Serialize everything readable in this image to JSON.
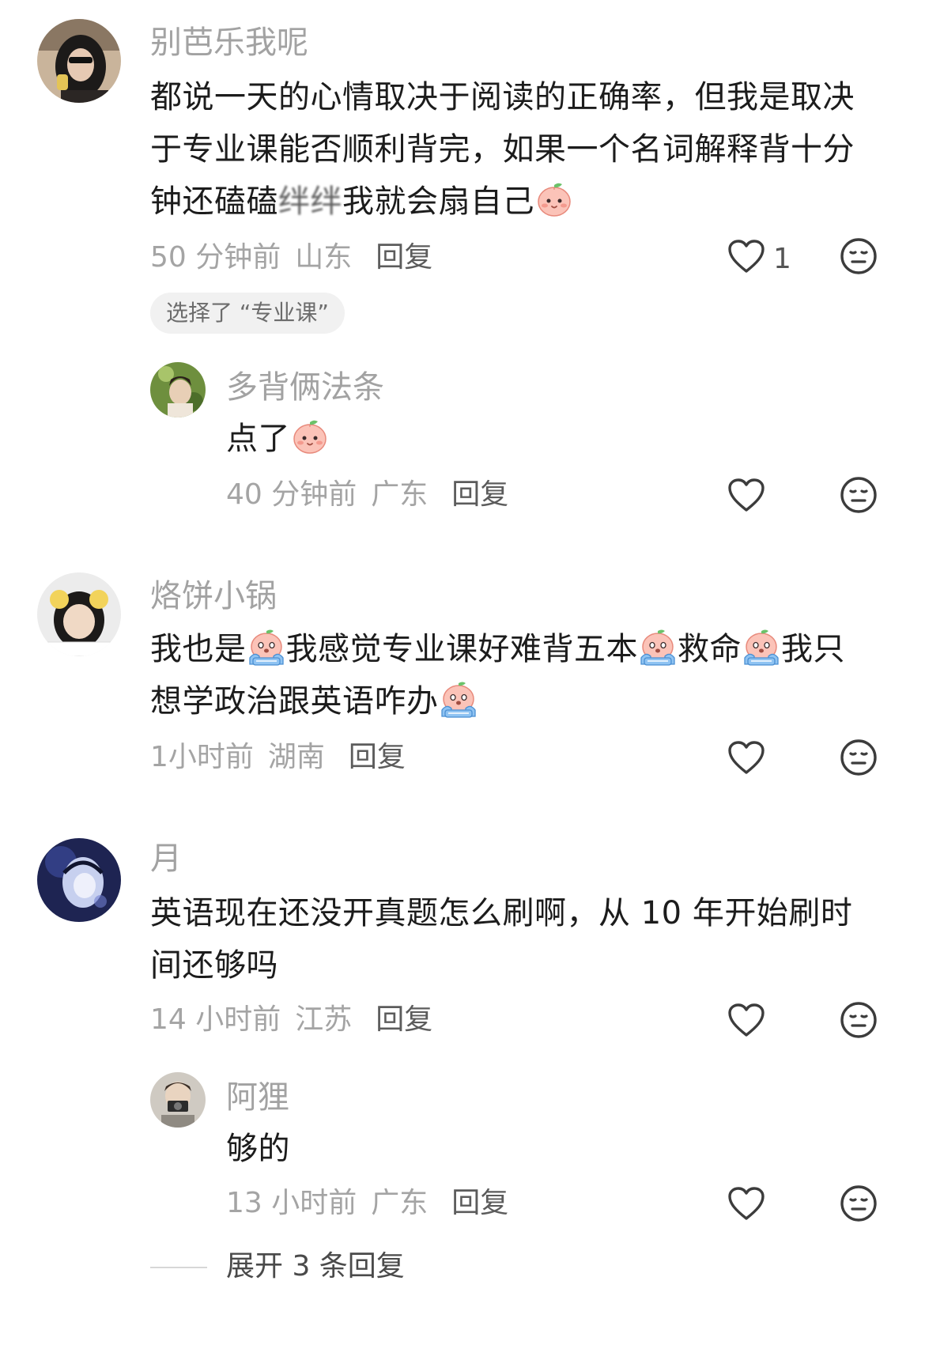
{
  "comments": [
    {
      "username": "别芭乐我呢",
      "text_parts": [
        "都说一天的心情取决于阅读的正确率，但我是取决于专业课能否顺利背完，如果一个名词解释背十分钟还磕磕",
        "绊绊",
        "我就会扇自己"
      ],
      "time": "50 分钟前",
      "location": "山东",
      "reply_label": "回复",
      "likes": "1",
      "chip": "选择了 “专业课”",
      "avatar_icon": "avatar-photo"
    },
    {
      "username": "多背俩法条",
      "text": "点了",
      "time": "40 分钟前",
      "location": "广东",
      "reply_label": "回复",
      "avatar_icon": "avatar-photo"
    },
    {
      "username": "烙饼小锅",
      "text_parts": [
        "我也是",
        "我感觉专业课好难背五本",
        "救命",
        "我只想学政治跟英语咋办"
      ],
      "time": "1小时前",
      "location": "湖南",
      "reply_label": "回复",
      "avatar_icon": "avatar-photo"
    },
    {
      "username": "月",
      "text": "英语现在还没开真题怎么刷啊，从 10 年开始刷时间还够吗",
      "time": "14 小时前",
      "location": "江苏",
      "reply_label": "回复",
      "avatar_icon": "avatar-anime"
    },
    {
      "username": "阿狸",
      "text": "够的",
      "time": "13 小时前",
      "location": "广东",
      "reply_label": "回复",
      "avatar_icon": "avatar-photo"
    }
  ],
  "expand_label": "展开 3 条回复",
  "icons": {
    "like": "heart-outline-icon",
    "dislike": "neutral-face-icon",
    "emoji_smile": "peach-smile-emoji",
    "emoji_cry": "crying-face-emoji"
  },
  "colors": {
    "text": "#1c1c1c",
    "meta": "#a4a4a4",
    "username": "#a2a2a2",
    "chip_bg": "#f1f1f1"
  }
}
